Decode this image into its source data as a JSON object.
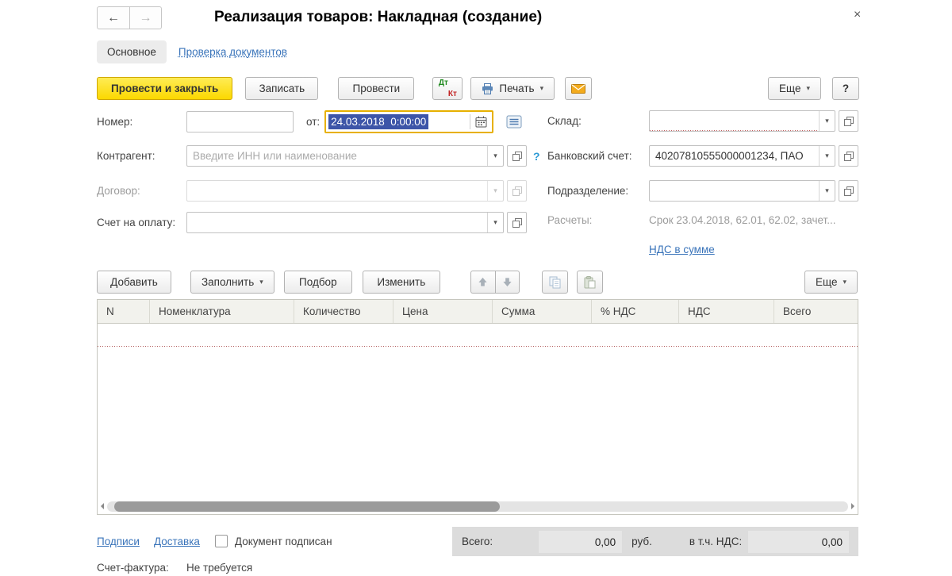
{
  "window": {
    "title": "Реализация товаров: Накладная (создание)"
  },
  "icons": {
    "back": "←",
    "forward": "→",
    "close": "×",
    "dropdown": "▾"
  },
  "tabs": {
    "main": "Основное",
    "check": "Проверка документов"
  },
  "toolbar": {
    "post_and_close": "Провести и закрыть",
    "save": "Записать",
    "post": "Провести",
    "dt": "Дт",
    "kt": "Кт",
    "print": "Печать",
    "more": "Еще",
    "help": "?"
  },
  "form": {
    "number_label": "Номер:",
    "number_value": "",
    "date_label": "от:",
    "date_value": "24.03.2018  0:00:00",
    "warehouse_label": "Склад:",
    "warehouse_value": "",
    "counterparty_label": "Контрагент:",
    "counterparty_placeholder": "Введите ИНН или наименование",
    "counterparty_help": "?",
    "bank_account_label": "Банковский счет:",
    "bank_account_value": "40207810555000001234, ПАО",
    "contract_label": "Договор:",
    "contract_value": "",
    "department_label": "Подразделение:",
    "department_value": "",
    "payment_invoice_label": "Счет на оплату:",
    "payment_invoice_value": "",
    "settlements_label": "Расчеты:",
    "settlements_value": "Срок 23.04.2018, 62.01, 62.02, зачет...",
    "vat_in_total_link": "НДС в сумме"
  },
  "items_toolbar": {
    "add": "Добавить",
    "fill": "Заполнить",
    "pick": "Подбор",
    "edit": "Изменить",
    "more": "Еще"
  },
  "table": {
    "columns": [
      "N",
      "Номенклатура",
      "Количество",
      "Цена",
      "Сумма",
      "% НДС",
      "НДС",
      "Всего"
    ],
    "rows": []
  },
  "footer": {
    "signatures_link": "Подписи",
    "delivery_link": "Доставка",
    "signed_label": "Документ подписан",
    "signed_checked": false,
    "total_label": "Всего:",
    "total_value": "0,00",
    "currency": "руб.",
    "vat_label": "в т.ч. НДС:",
    "vat_value": "0,00",
    "invoice_label": "Счет-фактура:",
    "invoice_value": "Не требуется"
  },
  "colors": {
    "accent_yellow": "#FBD800",
    "link_blue": "#3A74BA",
    "required_red": "#BE5E5E",
    "selection_blue": "#3D55A8",
    "focus_gold": "#E7B000",
    "totals_gray": "#DCDCDC"
  }
}
